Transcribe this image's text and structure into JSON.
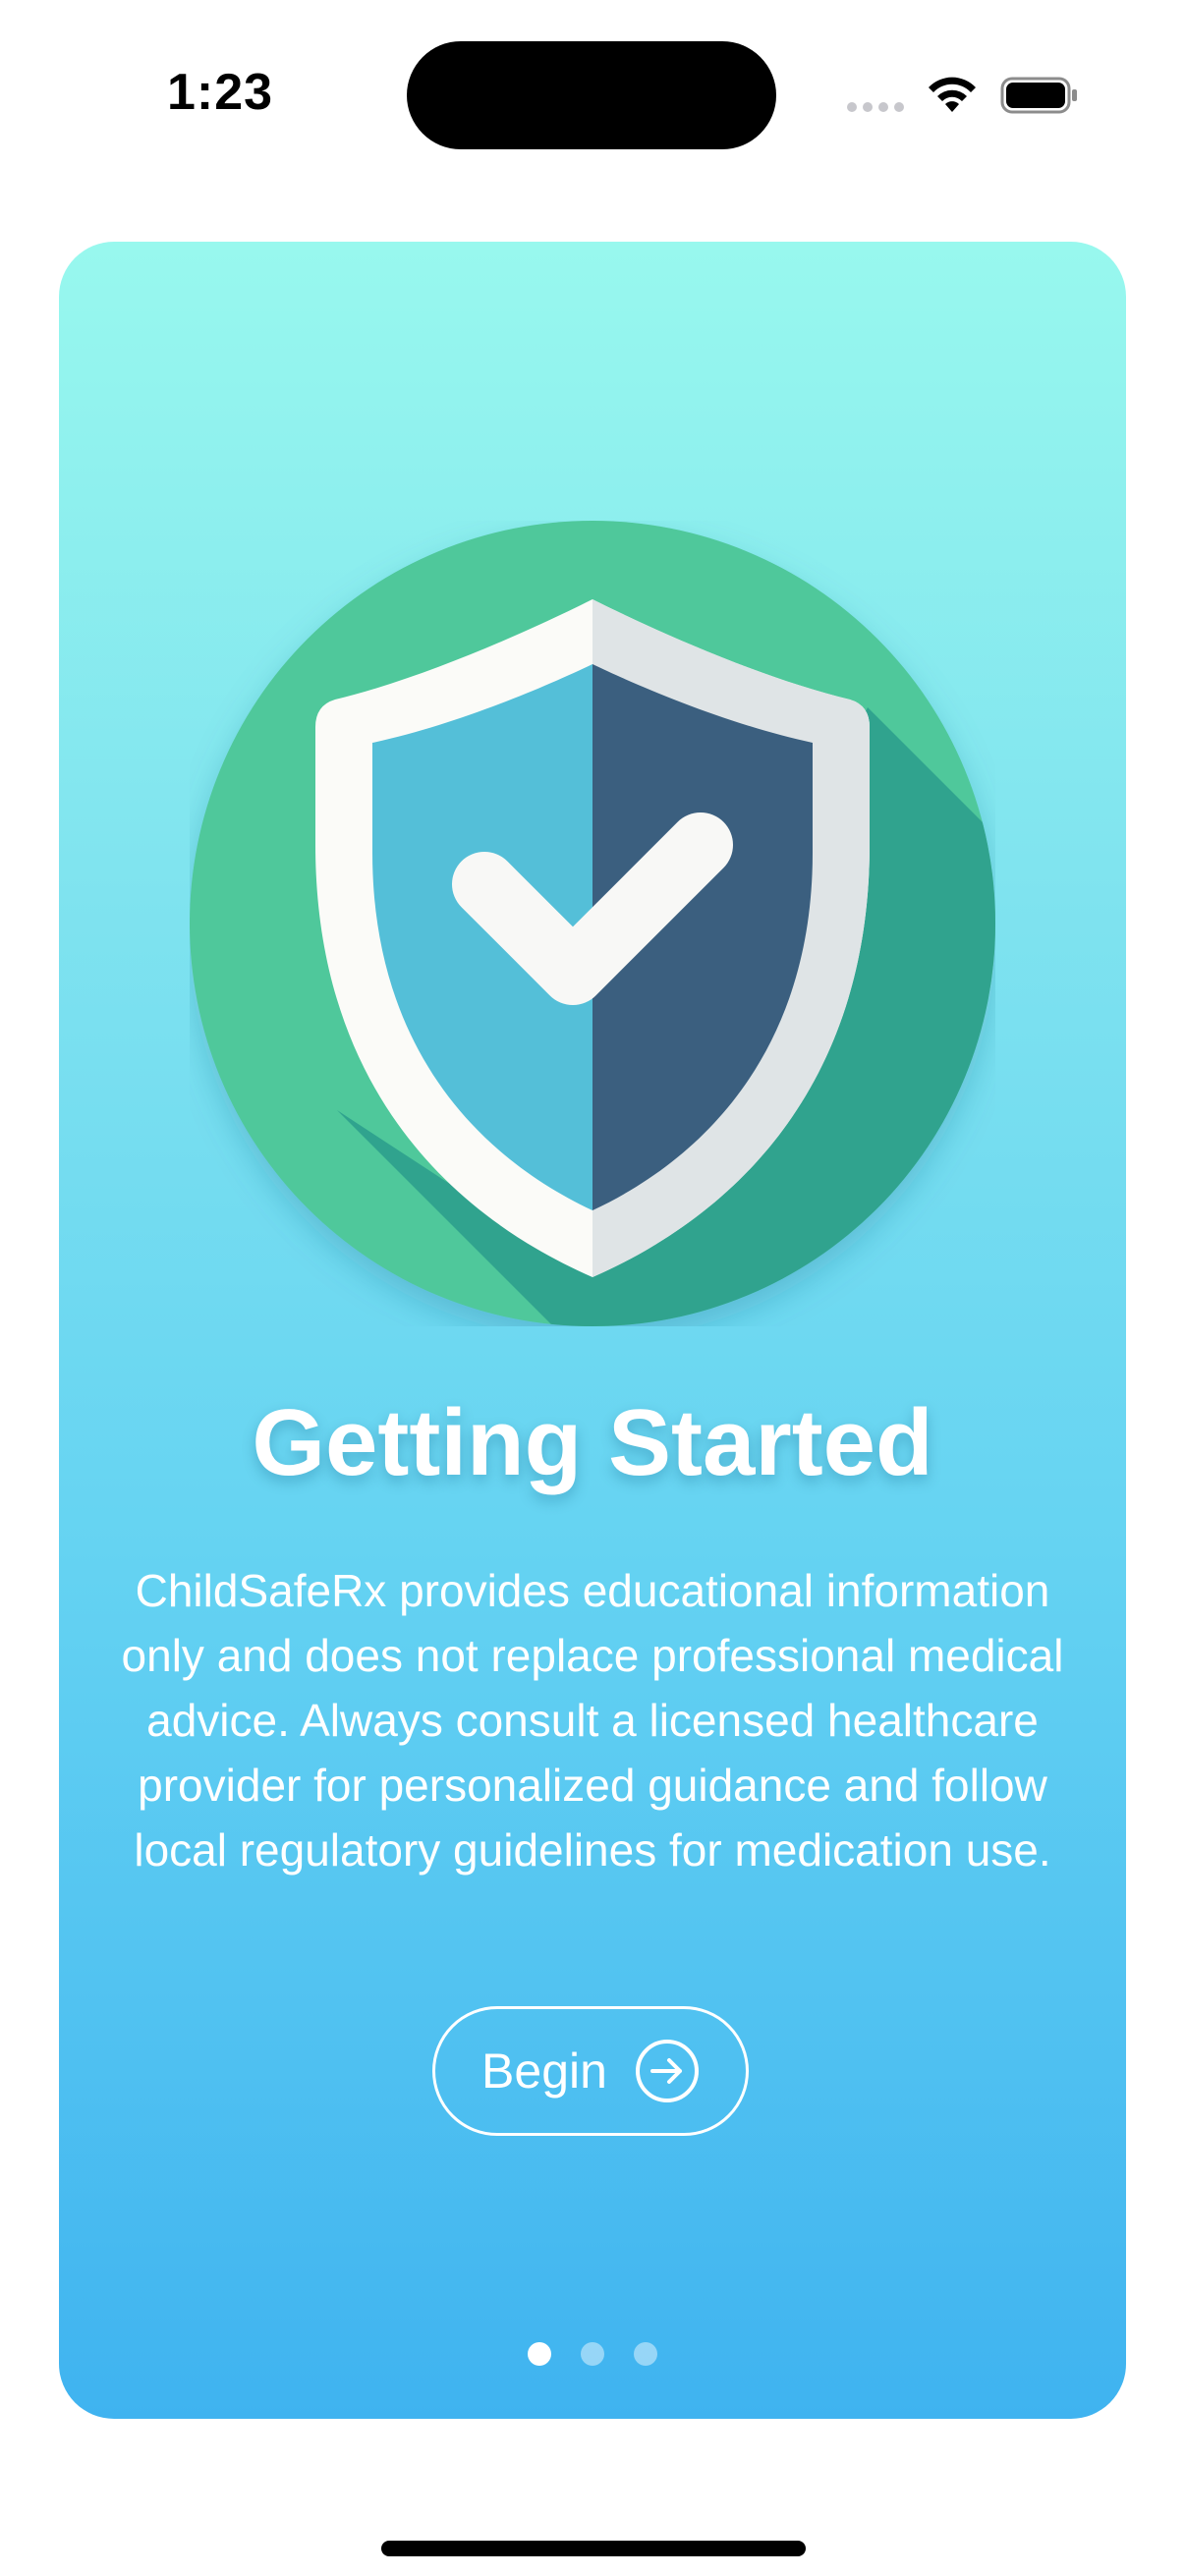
{
  "status_bar": {
    "time": "1:23"
  },
  "onboarding": {
    "title": "Getting Started",
    "description": "ChildSafeRx provides educational information only and does not replace professional medical advice. Always consult a licensed healthcare provider for personalized guidance and follow local regulatory guidelines for medication use.",
    "begin_label": "Begin",
    "hero_icon": "shield-check-icon",
    "pages_total": 3,
    "current_page": 1
  },
  "colors": {
    "gradient_top": "#98f8ee",
    "gradient_bottom": "#3fb3f0",
    "circle_green": "#4fc89b",
    "shield_dark": "#3b5f7f",
    "shield_light": "#54bfd8"
  }
}
